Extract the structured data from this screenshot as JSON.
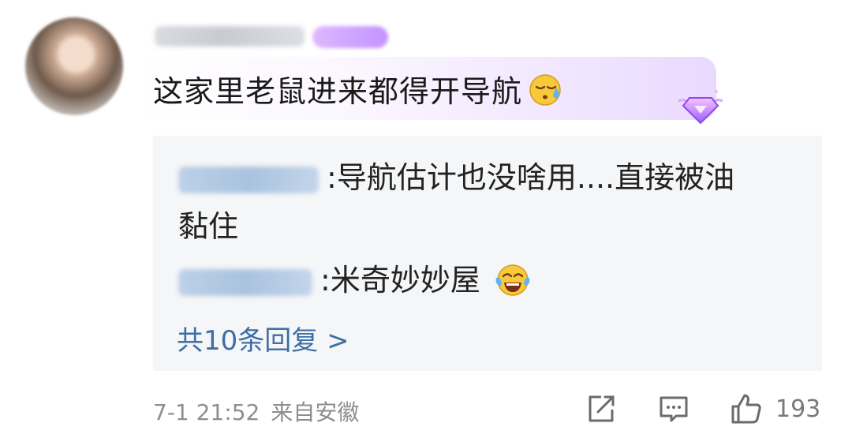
{
  "comment": {
    "text": "这家里老鼠进来都得开导航",
    "emoji": "sweat-smile-emoji"
  },
  "replies": [
    {
      "colon": ":",
      "text_line1": "导航估计也没啥用....直接被油",
      "text_line2": "黏住"
    },
    {
      "colon": ":",
      "text": "米奇妙妙屋",
      "emoji": "tears-of-joy-emoji"
    }
  ],
  "view_replies": "共10条回复 >",
  "meta": {
    "time": "7-1 21:52",
    "source": "来自安徽"
  },
  "actions": {
    "like_count": "193"
  },
  "colors": {
    "link": "#3d6ea6",
    "meta": "#8e8e8e",
    "reply_bg": "#f5f6f7",
    "badge": "#c393ff"
  }
}
